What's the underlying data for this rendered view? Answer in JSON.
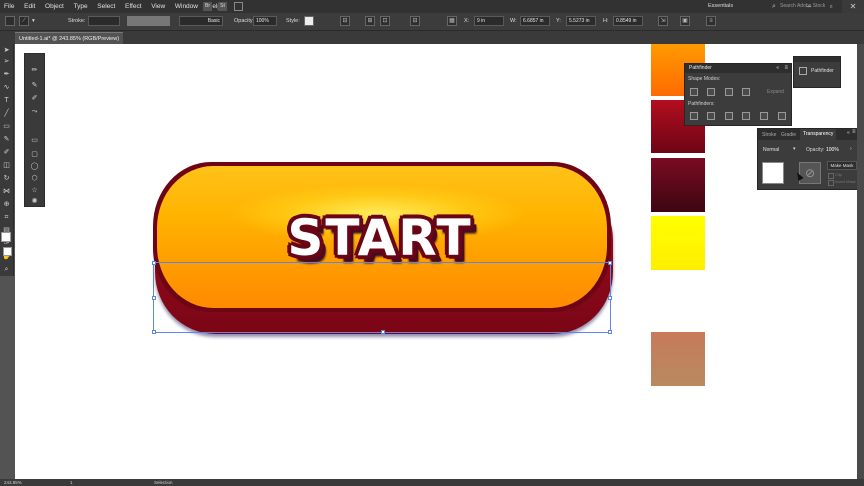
{
  "menu": {
    "items": [
      "File",
      "Edit",
      "Object",
      "Type",
      "Select",
      "Effect",
      "View",
      "Window",
      "Help"
    ],
    "workspace": "Essentials",
    "search_placeholder": "Search Adobe Stock"
  },
  "controlbar": {
    "stroke_label": "Stroke:",
    "brush_label": "Basic",
    "opacity_label": "Opacity:",
    "opacity_value": "100%",
    "style_label": "Style:",
    "x_label": "X:",
    "x_value": "9 in",
    "w_label": "W:",
    "w_value": "6.6857 in",
    "y_label": "Y:",
    "y_value": "5.5273 in",
    "h_label": "H:",
    "h_value": "0.8549 in"
  },
  "document": {
    "tab_title": "Untitled-1.ai* @ 243.85% (RGB/Preview)"
  },
  "artwork": {
    "button_text": "START"
  },
  "swatches": [
    {
      "name": "orange-gradient",
      "from": "#ff9a00",
      "to": "#ff6a00"
    },
    {
      "name": "red-gradient",
      "from": "#b30e1f",
      "to": "#6d0514"
    },
    {
      "name": "maroon-gradient",
      "from": "#7a0b22",
      "to": "#3d0612"
    },
    {
      "name": "yellow",
      "from": "#ffff00",
      "to": "#ffee00"
    },
    {
      "name": "tan-gradient",
      "from": "#c77a5a",
      "to": "#b88a60"
    }
  ],
  "pathfinder": {
    "title": "Pathfinder",
    "shape_modes_label": "Shape Modes:",
    "expand_label": "Expand",
    "pathfinders_label": "Pathfinders:"
  },
  "pathfinder_collapsed": {
    "title": "Pathfinder"
  },
  "transparency": {
    "tabs": [
      "Stroke",
      "Gradie",
      "Transparency"
    ],
    "blend_mode": "Normal",
    "opacity_label": "Opacity:",
    "opacity_value": "100%",
    "make_mask_label": "Make Mask",
    "clip_label": "Clip",
    "invert_label": "Invert Mask"
  },
  "status": {
    "zoom": "243.85%",
    "artboard": "1",
    "tool": "Selection"
  }
}
